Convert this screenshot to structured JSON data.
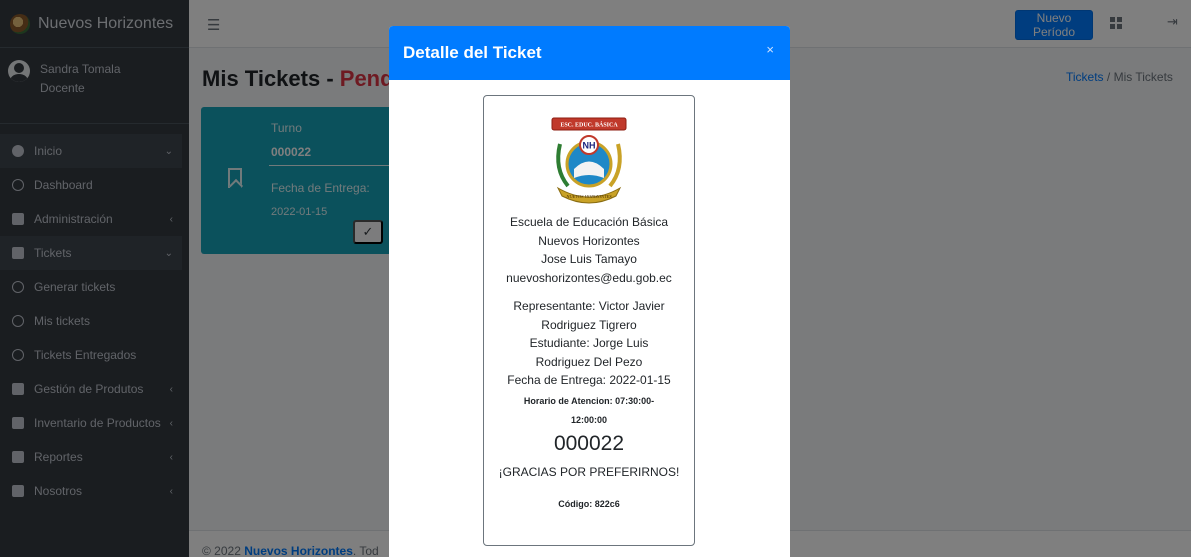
{
  "app": {
    "brand": "Nuevos Horizontes",
    "user_name": "Sandra Tomala",
    "user_role": "Docente"
  },
  "sidebar": {
    "items": [
      {
        "label": "Inicio",
        "icon": "tachometer-icon",
        "arrow": "⌄"
      },
      {
        "label": "Dashboard",
        "icon": "circle-icon",
        "arrow": ""
      },
      {
        "label": "Administración",
        "icon": "users-icon",
        "arrow": "‹"
      },
      {
        "label": "Tickets",
        "icon": "ticket-icon",
        "arrow": "⌄"
      },
      {
        "label": "Generar tickets",
        "icon": "circle-icon",
        "arrow": ""
      },
      {
        "label": "Mis tickets",
        "icon": "circle-icon",
        "arrow": ""
      },
      {
        "label": "Tickets Entregados",
        "icon": "circle-icon",
        "arrow": ""
      },
      {
        "label": "Gestión de Produtos",
        "icon": "box-icon",
        "arrow": "‹"
      },
      {
        "label": "Inventario de Productos",
        "icon": "check-square-icon",
        "arrow": "‹"
      },
      {
        "label": "Reportes",
        "icon": "chart-icon",
        "arrow": "‹"
      },
      {
        "label": "Nosotros",
        "icon": "book-icon",
        "arrow": "‹"
      }
    ]
  },
  "topbar": {
    "menu_icon": "☰",
    "new_period_label": "Nuevo Período",
    "logout_icon": "⇥"
  },
  "page": {
    "title": "Mis Tickets - ",
    "title_status": "Pend",
    "breadcrumb_link": "Tickets",
    "breadcrumb_sep": "/",
    "breadcrumb_current": "Mis Tickets"
  },
  "ticket_card": {
    "turno_label": "Turno",
    "turno_value": "000022",
    "fecha_label": "Fecha de Entrega:",
    "fecha_value": "2022-01-15",
    "check_icon": "✓"
  },
  "footer": {
    "prefix": "© 2022 ",
    "brand": "Nuevos Horizontes",
    "suffix": ". Tod"
  },
  "modal": {
    "title": "Detalle del Ticket",
    "close": "×",
    "ticket": {
      "logo_text": "ESC. EDUC. BÁSICA",
      "logo_monogram": "NH",
      "logo_ribbon": "NUEVOS HORIZONTES",
      "school_line1": "Escuela de Educación Básica",
      "school_line2": "Nuevos Horizontes",
      "person": "Jose Luis Tamayo",
      "email": "nuevoshorizontes@edu.gob.ec",
      "rep_line1": "Representante: Victor Javier",
      "rep_line2": "Rodriguez Tigrero",
      "student_line1": "Estudiante: Jorge Luis",
      "student_line2": "Rodriguez Del Pezo",
      "delivery": "Fecha de Entrega: 2022-01-15",
      "horario_line1": "Horario de Atencion: 07:30:00-",
      "horario_line2": "12:00:00",
      "turno": "000022",
      "gracias": "¡GRACIAS POR PREFERIRNOS!",
      "codigo": "Código: 822c6"
    }
  }
}
